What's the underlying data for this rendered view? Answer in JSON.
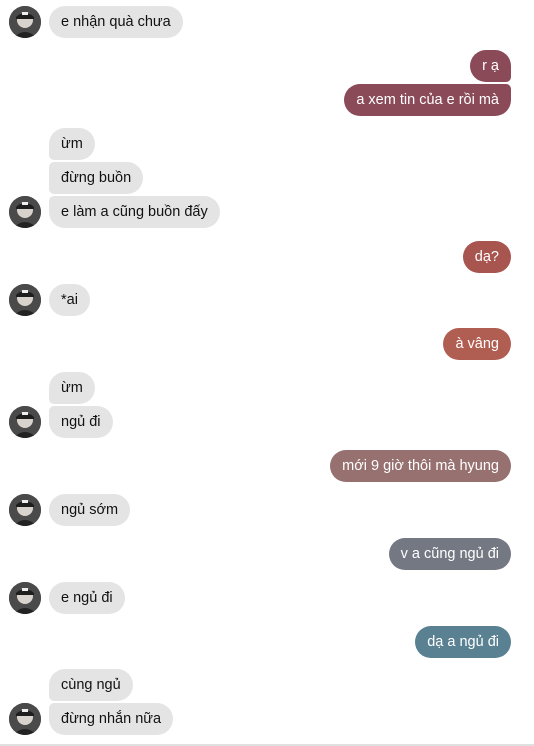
{
  "messages": [
    {
      "text": "e nhận quà chưa",
      "side": "in",
      "avatar": true
    },
    {
      "text": "r ạ",
      "side": "out",
      "color": "#8a4a57"
    },
    {
      "text": "a xem tin của e rồi mà",
      "side": "out",
      "color": "#8a4a57"
    },
    {
      "text": "ừm",
      "side": "in"
    },
    {
      "text": "đừng buồn",
      "side": "in"
    },
    {
      "text": "e làm a cũng buồn đấy",
      "side": "in",
      "avatar": true
    },
    {
      "text": "dạ?",
      "side": "out",
      "color": "#a8544f"
    },
    {
      "text": "*ai",
      "side": "in",
      "avatar": true
    },
    {
      "text": "à vâng",
      "side": "out",
      "color": "#b15e52"
    },
    {
      "text": "ừm",
      "side": "in"
    },
    {
      "text": "ngủ đi",
      "side": "in",
      "avatar": true
    },
    {
      "text": "mới 9 giờ thôi mà hyung",
      "side": "out",
      "color": "#977070"
    },
    {
      "text": "ngủ sớm",
      "side": "in",
      "avatar": true
    },
    {
      "text": "v a cũng ngủ đi",
      "side": "out",
      "color": "#737882"
    },
    {
      "text": "e ngủ đi",
      "side": "in",
      "avatar": true
    },
    {
      "text": "dạ a ngủ đi",
      "side": "out",
      "color": "#5a8192"
    },
    {
      "text": "cùng ngủ",
      "side": "in"
    },
    {
      "text": "đừng nhắn nữa",
      "side": "in",
      "avatar": true
    }
  ],
  "icons": {
    "avatar": "user-avatar-icon"
  }
}
